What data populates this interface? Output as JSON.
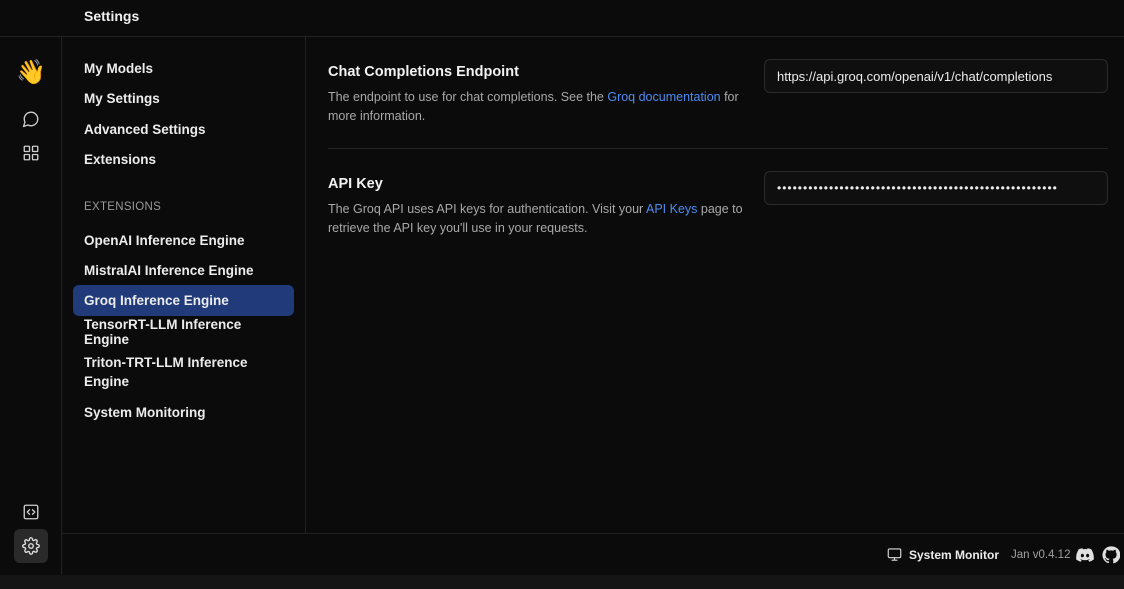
{
  "header": {
    "title": "Settings"
  },
  "rail": {
    "icons": [
      "waving-hand-icon",
      "chat-icon",
      "grid-icon",
      "code-icon",
      "gear-icon"
    ],
    "logo_glyph": "👋"
  },
  "sidebar": {
    "items": [
      {
        "label": "My Models"
      },
      {
        "label": "My Settings"
      },
      {
        "label": "Advanced Settings"
      },
      {
        "label": "Extensions"
      }
    ],
    "section_label": "EXTENSIONS",
    "extensions": [
      {
        "label": "OpenAI Inference Engine"
      },
      {
        "label": "MistralAI Inference Engine"
      },
      {
        "label": "Groq Inference Engine",
        "active": true
      },
      {
        "label": "TensorRT-LLM Inference Engine"
      },
      {
        "label": "Triton-TRT-LLM Inference Engine"
      },
      {
        "label": "System Monitoring"
      }
    ]
  },
  "settings": {
    "endpoint": {
      "label": "Chat Completions Endpoint",
      "desc_before": "The endpoint to use for chat completions. See the ",
      "link": "Groq documentation",
      "desc_after": " for more information.",
      "value": "https://api.groq.com/openai/v1/chat/completions"
    },
    "api_key": {
      "label": "API Key",
      "desc_before": "The Groq API uses API keys for authentication. Visit your ",
      "link": "API Keys",
      "desc_after": " page to retrieve the API key you'll use in your requests.",
      "value": "••••••••••••••••••••••••••••••••••••••••••••••••••••••"
    }
  },
  "statusbar": {
    "monitor_label": "System Monitor",
    "version": "Jan v0.4.12"
  },
  "colors": {
    "background": "#0b0b0b",
    "active_item": "#213b7a",
    "link": "#4f8cf0"
  }
}
